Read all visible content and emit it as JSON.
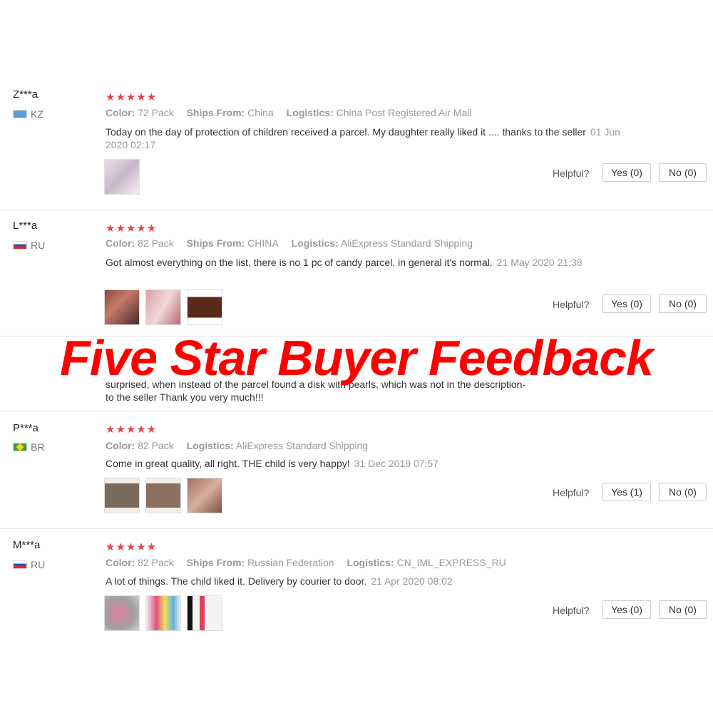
{
  "banner": "Five Star Buyer Feedback",
  "helpful_label": "Helpful?",
  "labels": {
    "color": "Color:",
    "ships_from": "Ships From:",
    "logistics": "Logistics:"
  },
  "reviews": [
    {
      "user": "Z***a",
      "country": "KZ",
      "stars": "★★★★★",
      "color": "72 Pack",
      "ships_from": "China",
      "logistics": "China Post Registered Air Mail",
      "text": "Today on the day of protection of children received a parcel. My daughter really liked it .... thanks to the seller",
      "date": "01 Jun 2020 02:17",
      "yes": "Yes (0)",
      "no": "No (0)"
    },
    {
      "user": "L***a",
      "country": "RU",
      "stars": "★★★★★",
      "color": "82 Pack",
      "ships_from": "CHINA",
      "logistics": "AliExpress Standard Shipping",
      "text": "Got almost everything on the list, there is no 1 pc of candy parcel, in general it's normal.",
      "date": "21 May 2020 21:38",
      "yes": "Yes (0)",
      "no": "No (0)"
    },
    {
      "partial_line1": "surprised, when instead of the parcel found a disk with pearls, which was not in the description-",
      "partial_line2": "to the seller Thank you very much!!!"
    },
    {
      "user": "P***a",
      "country": "BR",
      "stars": "★★★★★",
      "color": "82 Pack",
      "logistics": "AliExpress Standard Shipping",
      "text": "Come in great quality, all right. THE child is very happy!",
      "date": "31 Dec 2019 07:57",
      "yes": "Yes (1)",
      "no": "No (0)"
    },
    {
      "user": "M***a",
      "country": "RU",
      "stars": "★★★★★",
      "color": "82 Pack",
      "ships_from": "Russian Federation",
      "logistics": "CN_IML_EXPRESS_RU",
      "text": "A lot of things. The child liked it. Delivery by courier to door.",
      "date": "21 Apr 2020 08:02",
      "yes": "Yes (0)",
      "no": "No (0)"
    }
  ]
}
